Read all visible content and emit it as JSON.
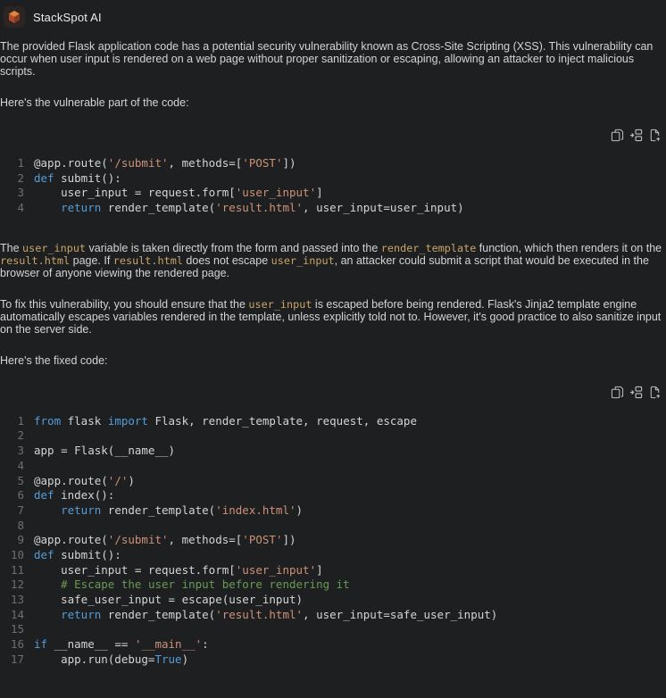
{
  "header": {
    "title": "StackSpot AI",
    "logo_icon": "stackspot-logo-icon"
  },
  "colors": {
    "background": "#1e1f21",
    "text": "#d4d4d4",
    "inline_code": "#c9a469",
    "syntax_keyword": "#569cd6",
    "syntax_string": "#ce9178",
    "syntax_comment": "#6a9955",
    "line_number": "#6f6f6f",
    "logo_orange": "#de8743"
  },
  "content": [
    {
      "type": "paragraph",
      "segments": [
        "The provided Flask application code has a potential security vulnerability known as Cross-Site Scripting (XSS). This vulnerability can occur when user input is rendered on a web page without proper sanitization or escaping, allowing an attacker to inject malicious scripts."
      ]
    },
    {
      "type": "paragraph",
      "segments": [
        "Here's the vulnerable part of the code:"
      ]
    },
    {
      "type": "code",
      "toolbar": [
        {
          "button": "copy-code-button",
          "icon": "copy-icon"
        },
        {
          "button": "insert-code-button",
          "icon": "insert-into-editor-icon"
        },
        {
          "button": "new-file-button",
          "icon": "new-file-icon"
        }
      ],
      "lines": [
        [
          [
            "p",
            "@app.route("
          ],
          [
            "s",
            "'/submit'"
          ],
          [
            "p",
            ", methods=["
          ],
          [
            "s",
            "'POST'"
          ],
          [
            "p",
            "])"
          ]
        ],
        [
          [
            "k",
            "def"
          ],
          [
            "p",
            " submit():"
          ]
        ],
        [
          [
            "p",
            "    user_input = request.form["
          ],
          [
            "s",
            "'user_input'"
          ],
          [
            "p",
            "]"
          ]
        ],
        [
          [
            "p",
            "    "
          ],
          [
            "k",
            "return"
          ],
          [
            "p",
            " render_template("
          ],
          [
            "s",
            "'result.html'"
          ],
          [
            "p",
            ", user_input=user_input)"
          ]
        ]
      ]
    },
    {
      "type": "paragraph",
      "segments": [
        "The ",
        {
          "code": "user_input"
        },
        " variable is taken directly from the form and passed into the ",
        {
          "code": "render_template"
        },
        " function, which then renders it on the ",
        {
          "code": "result.html"
        },
        " page. If ",
        {
          "code": "result.html"
        },
        " does not escape ",
        {
          "code": "user_input"
        },
        ", an attacker could submit a script that would be executed in the browser of anyone viewing the rendered page."
      ]
    },
    {
      "type": "paragraph",
      "segments": [
        "To fix this vulnerability, you should ensure that the ",
        {
          "code": "user_input"
        },
        " is escaped before being rendered. Flask's Jinja2 template engine automatically escapes variables rendered in the template, unless explicitly told not to. However, it's good practice to also sanitize input on the server side."
      ]
    },
    {
      "type": "paragraph",
      "segments": [
        "Here's the fixed code:"
      ]
    },
    {
      "type": "code",
      "toolbar": [
        {
          "button": "copy-code-button",
          "icon": "copy-icon"
        },
        {
          "button": "insert-code-button",
          "icon": "insert-into-editor-icon"
        },
        {
          "button": "new-file-button",
          "icon": "new-file-icon"
        }
      ],
      "lines": [
        [
          [
            "k",
            "from"
          ],
          [
            "p",
            " flask "
          ],
          [
            "k",
            "import"
          ],
          [
            "p",
            " Flask, render_template, request, escape"
          ]
        ],
        [],
        [
          [
            "p",
            "app = Flask(__name__)"
          ]
        ],
        [],
        [
          [
            "p",
            "@app.route("
          ],
          [
            "s",
            "'/'"
          ],
          [
            "p",
            ")"
          ]
        ],
        [
          [
            "k",
            "def"
          ],
          [
            "p",
            " index():"
          ]
        ],
        [
          [
            "p",
            "    "
          ],
          [
            "k",
            "return"
          ],
          [
            "p",
            " render_template("
          ],
          [
            "s",
            "'index.html'"
          ],
          [
            "p",
            ")"
          ]
        ],
        [],
        [
          [
            "p",
            "@app.route("
          ],
          [
            "s",
            "'/submit'"
          ],
          [
            "p",
            ", methods=["
          ],
          [
            "s",
            "'POST'"
          ],
          [
            "p",
            "])"
          ]
        ],
        [
          [
            "k",
            "def"
          ],
          [
            "p",
            " submit():"
          ]
        ],
        [
          [
            "p",
            "    user_input = request.form["
          ],
          [
            "s",
            "'user_input'"
          ],
          [
            "p",
            "]"
          ]
        ],
        [
          [
            "p",
            "    "
          ],
          [
            "c",
            "# Escape the user input before rendering it"
          ]
        ],
        [
          [
            "p",
            "    safe_user_input = escape(user_input)"
          ]
        ],
        [
          [
            "p",
            "    "
          ],
          [
            "k",
            "return"
          ],
          [
            "p",
            " render_template("
          ],
          [
            "s",
            "'result.html'"
          ],
          [
            "p",
            ", user_input=safe_user_input)"
          ]
        ],
        [],
        [
          [
            "k",
            "if"
          ],
          [
            "p",
            " __name__ == "
          ],
          [
            "s",
            "'__main__'"
          ],
          [
            "p",
            ":"
          ]
        ],
        [
          [
            "p",
            "    app.run(debug="
          ],
          [
            "k",
            "True"
          ],
          [
            "p",
            ")"
          ]
        ]
      ]
    }
  ]
}
